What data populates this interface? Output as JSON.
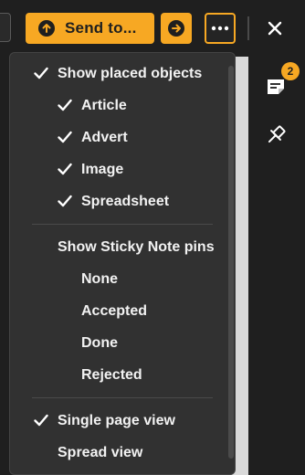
{
  "toolbar": {
    "send_label": "Send to...",
    "send_icon": "arrow-up-circle",
    "go_icon": "arrow-right-circle",
    "more_icon": "more-horizontal",
    "close_icon": "close"
  },
  "right_rail": {
    "notes_badge": "2",
    "notes_icon": "sticky-note",
    "pin_icon": "pushpin"
  },
  "menu": {
    "placed_header": "Show placed objects",
    "placed_items": [
      {
        "label": "Article",
        "checked": true
      },
      {
        "label": "Advert",
        "checked": true
      },
      {
        "label": "Image",
        "checked": true
      },
      {
        "label": "Spreadsheet",
        "checked": true
      }
    ],
    "sticky_header": "Show Sticky Note pins",
    "sticky_items": [
      {
        "label": "None",
        "checked": false
      },
      {
        "label": "Accepted",
        "checked": false
      },
      {
        "label": "Done",
        "checked": false
      },
      {
        "label": "Rejected",
        "checked": false
      }
    ],
    "view_items": [
      {
        "label": "Single page view",
        "checked": true
      },
      {
        "label": "Spread view",
        "checked": false
      }
    ]
  },
  "colors": {
    "accent": "#f7a823",
    "menu_bg": "#313131",
    "page_bg": "#1f1f1f"
  }
}
